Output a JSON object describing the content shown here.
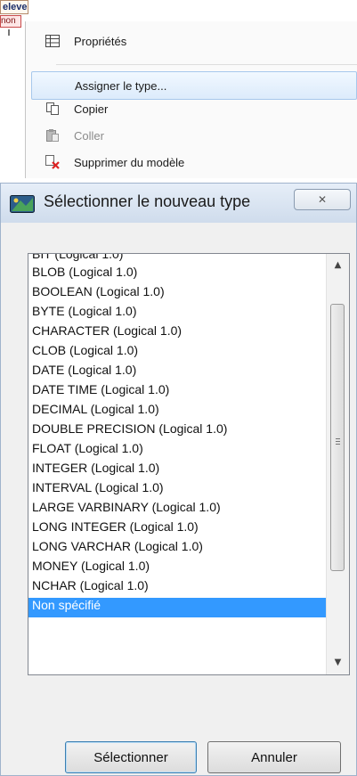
{
  "entity": {
    "name": "eleve",
    "attr": "non"
  },
  "context_menu": {
    "items": [
      {
        "label": "Propriétés",
        "icon": "table-icon",
        "enabled": true
      },
      {
        "label": "Assigner le type...",
        "icon": "",
        "enabled": true,
        "highlighted": true
      },
      {
        "label": "Copier",
        "icon": "copy-icon",
        "enabled": true
      },
      {
        "label": "Coller",
        "icon": "paste-icon",
        "enabled": false
      },
      {
        "label": "Supprimer du modèle",
        "icon": "delete-icon",
        "enabled": true
      }
    ]
  },
  "dialog": {
    "title": "Sélectionner le nouveau type",
    "close_label": "✕",
    "list": {
      "partial_top": "BIT  (Logical 1.0)",
      "items": [
        "BLOB  (Logical 1.0)",
        "BOOLEAN  (Logical 1.0)",
        "BYTE  (Logical 1.0)",
        "CHARACTER  (Logical 1.0)",
        "CLOB  (Logical 1.0)",
        "DATE  (Logical 1.0)",
        "DATE TIME  (Logical 1.0)",
        "DECIMAL  (Logical 1.0)",
        "DOUBLE PRECISION  (Logical 1.0)",
        "FLOAT  (Logical 1.0)",
        "INTEGER  (Logical 1.0)",
        "INTERVAL  (Logical 1.0)",
        "LARGE VARBINARY  (Logical 1.0)",
        "LONG INTEGER  (Logical 1.0)",
        "LONG VARCHAR  (Logical 1.0)",
        "MONEY  (Logical 1.0)",
        "NCHAR  (Logical 1.0)",
        "Non spécifié"
      ],
      "selected": "Non spécifié"
    },
    "buttons": {
      "select": "Sélectionner",
      "cancel": "Annuler"
    }
  },
  "colors": {
    "selection": "#3399ff",
    "hover_border": "#a7c8ec"
  }
}
